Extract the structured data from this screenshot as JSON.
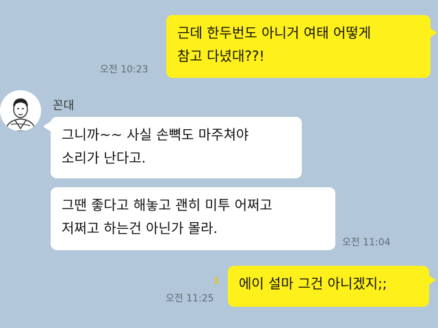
{
  "chat": {
    "msg1": {
      "lines": [
        "근데 한두번도 아니거 여태 어떻게",
        "참고 다녔대??!"
      ],
      "time": "오전 10:23"
    },
    "sender": {
      "name": "꼰대",
      "avatar": "man-in-hanbok-avatar"
    },
    "msg2": {
      "lines": [
        "그니까~~ 사실 손뼉도 마주쳐야",
        "소리가 난다고."
      ]
    },
    "msg3": {
      "lines": [
        "그땐 좋다고 해놓고 괜히 미투 어쩌고",
        "저쩌고 하는건 아닌가 몰라."
      ],
      "time": "오전 11:04"
    },
    "msg4": {
      "lines": [
        "에이 설마 그건 아니겠지;;"
      ],
      "time": "오전 11:25",
      "unread": "1"
    }
  },
  "colors": {
    "background": "#b2c7d9",
    "outgoing_bubble": "#fef01b",
    "incoming_bubble": "#ffffff",
    "unread": "#f0c400"
  }
}
